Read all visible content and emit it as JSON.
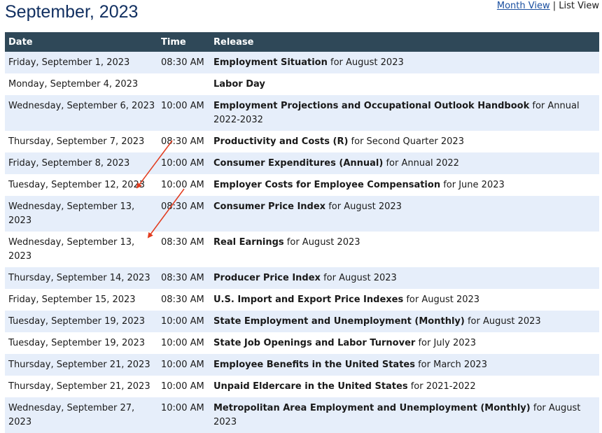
{
  "title": "September, 2023",
  "view_switch": {
    "month_view": "Month View",
    "separator": "|",
    "list_view": "List View"
  },
  "table": {
    "headers": {
      "date": "Date",
      "time": "Time",
      "release": "Release"
    },
    "rows": [
      {
        "date": "Friday, September 1, 2023",
        "time": "08:30 AM",
        "name": "Employment Situation",
        "period": "for August 2023"
      },
      {
        "date": "Monday, September 4, 2023",
        "time": "",
        "name": "Labor Day",
        "period": ""
      },
      {
        "date": "Wednesday, September 6, 2023",
        "time": "10:00 AM",
        "name": "Employment Projections and Occupational Outlook Handbook",
        "period": "for Annual 2022-2032"
      },
      {
        "date": "Thursday, September 7, 2023",
        "time": "08:30 AM",
        "name": "Productivity and Costs (R)",
        "period": "for Second Quarter 2023"
      },
      {
        "date": "Friday, September 8, 2023",
        "time": "10:00 AM",
        "name": "Consumer Expenditures (Annual)",
        "period": "for Annual 2022"
      },
      {
        "date": "Tuesday, September 12, 2023",
        "time": "10:00 AM",
        "name": "Employer Costs for Employee Compensation",
        "period": "for June 2023"
      },
      {
        "date": "Wednesday, September 13, 2023",
        "time": "08:30 AM",
        "name": "Consumer Price Index",
        "period": "for August 2023"
      },
      {
        "date": "Wednesday, September 13, 2023",
        "time": "08:30 AM",
        "name": "Real Earnings",
        "period": "for August 2023"
      },
      {
        "date": "Thursday, September 14, 2023",
        "time": "08:30 AM",
        "name": "Producer Price Index",
        "period": "for August 2023"
      },
      {
        "date": "Friday, September 15, 2023",
        "time": "08:30 AM",
        "name": "U.S. Import and Export Price Indexes",
        "period": "for August 2023"
      },
      {
        "date": "Tuesday, September 19, 2023",
        "time": "10:00 AM",
        "name": "State Employment and Unemployment (Monthly)",
        "period": "for August 2023"
      },
      {
        "date": "Tuesday, September 19, 2023",
        "time": "10:00 AM",
        "name": "State Job Openings and Labor Turnover",
        "period": "for July 2023"
      },
      {
        "date": "Thursday, September 21, 2023",
        "time": "10:00 AM",
        "name": "Employee Benefits in the United States",
        "period": "for March 2023"
      },
      {
        "date": "Thursday, September 21, 2023",
        "time": "10:00 AM",
        "name": "Unpaid Eldercare in the United States",
        "period": "for 2021-2022"
      },
      {
        "date": "Wednesday, September 27, 2023",
        "time": "10:00 AM",
        "name": "Metropolitan Area Employment and Unemployment (Monthly)",
        "period": "for August 2023"
      }
    ]
  },
  "colors": {
    "header_bg": "#2f4858",
    "stripe_bg": "#e6eefa",
    "title_color": "#123061",
    "annotation_arrow": "#e23b1e"
  }
}
